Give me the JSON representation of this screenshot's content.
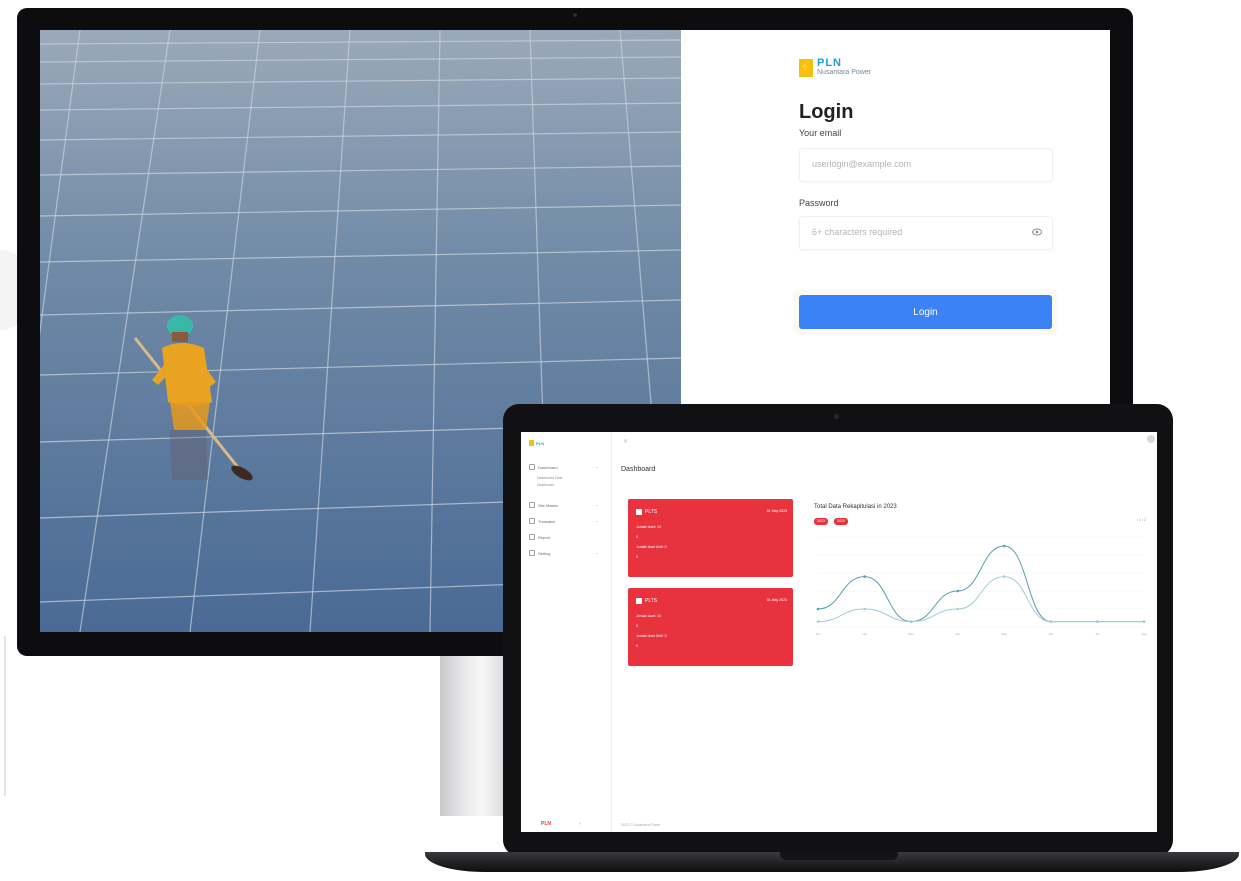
{
  "login": {
    "logo_name": "PLN",
    "logo_sub": "Nusantara Power",
    "title": "Login",
    "email_label": "Your email",
    "email_placeholder": "userlogin@example.com",
    "password_label": "Password",
    "password_placeholder": "6+ characters required",
    "button_label": "Login"
  },
  "dashboard": {
    "logo_name": "PLN",
    "page_title": "Dashboard",
    "sidebar": [
      {
        "label": "Dashboard",
        "sub": [
          "Dashboard Data",
          "Dashboard"
        ]
      },
      {
        "label": "Site Master"
      },
      {
        "label": "Transaksi"
      },
      {
        "label": "Report"
      },
      {
        "label": "Setting"
      }
    ],
    "cards": [
      {
        "name": "PLTS",
        "date": "01 May 2023",
        "rows": [
          "Jumlah Aset: 10",
          "0",
          "Jumlah Aset Aktif: 0",
          "0"
        ]
      },
      {
        "name": "PLTS",
        "date": "01 May 2023",
        "rows": [
          "Jumlah Aset: 10",
          "0",
          "Jumlah Aset Aktif: 0",
          "0"
        ]
      }
    ],
    "chart_title": "Total Data Rekapitulasi in 2023",
    "pills": [
      "2023",
      "2022"
    ],
    "legend": "• 1  • 2",
    "footer_brand": "PLN",
    "footer_copy": "2023 © Nusantara Power"
  },
  "chart_data": {
    "type": "line",
    "title": "Total Data Rekapitulasi in 2023",
    "categories": [
      "Jan",
      "Feb",
      "Mar",
      "Apr",
      "May",
      "Jun",
      "Jul",
      "Aug"
    ],
    "series": [
      {
        "values": [
          10,
          28,
          3,
          20,
          45,
          3,
          3,
          3
        ]
      },
      {
        "values": [
          3,
          10,
          3,
          10,
          28,
          3,
          3,
          3
        ]
      }
    ],
    "ylim": [
      0,
      50
    ]
  },
  "colors": {
    "primary": "#3b82f6",
    "card_red": "#e8333f",
    "line1": "#5a9fb0",
    "line2": "#a7cdd6"
  }
}
